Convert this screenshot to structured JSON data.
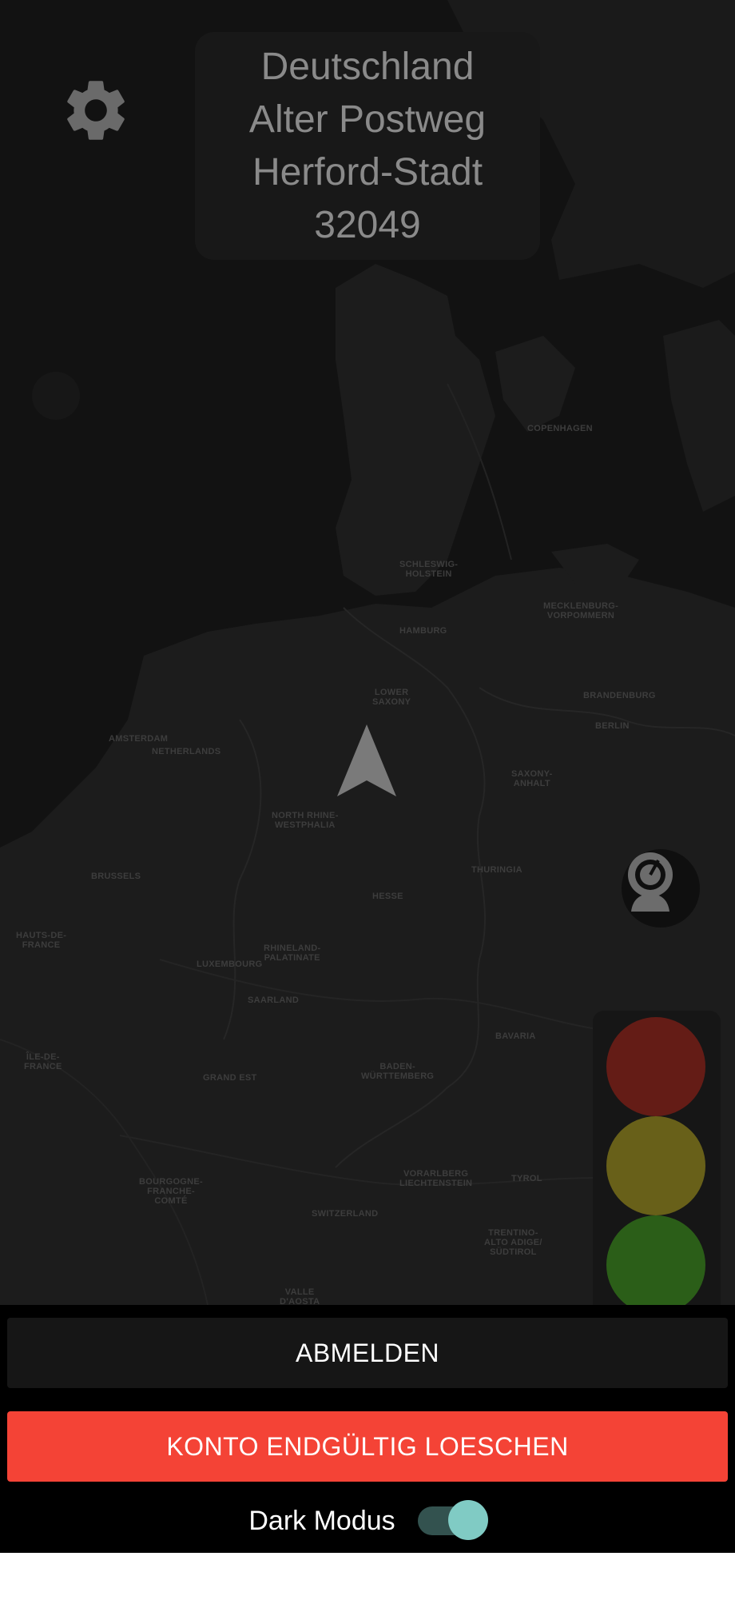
{
  "address": {
    "country": "Deutschland",
    "street": "Alter Postweg",
    "city": "Herford-Stadt",
    "postal_code": "32049"
  },
  "icons": {
    "settings": "gear-icon",
    "navigation": "navigation-arrow-icon",
    "speed_camera": "speed-camera-icon"
  },
  "traffic_light": {
    "red": "#641c16",
    "yellow": "#686019",
    "green": "#2b5e18"
  },
  "map_labels": [
    {
      "text": "SCHLESWIG-\nHOLSTEIN"
    },
    {
      "text": "HAMBURG"
    },
    {
      "text": "MECKLENBURG-\nVORPOMMERN"
    },
    {
      "text": "BRANDENBURG"
    },
    {
      "text": "BERLIN"
    },
    {
      "text": "LOWER\nSAXONY"
    },
    {
      "text": "NETHERLANDS"
    },
    {
      "text": "AMSTERDAM"
    },
    {
      "text": "NORTH RHINE-\nWESTPHALIA"
    },
    {
      "text": "SAXONY-\nANHALT"
    },
    {
      "text": "THURINGIA"
    },
    {
      "text": "HESSE"
    },
    {
      "text": "RHINELAND-\nPALATINATE"
    },
    {
      "text": "LUXEMBOURG"
    },
    {
      "text": "SAARLAND"
    },
    {
      "text": "BAVARIA"
    },
    {
      "text": "BADEN-\nWÜRTTEMBERG"
    },
    {
      "text": "GRAND EST"
    },
    {
      "text": "BOURGOGNE-\nFRANCHE-\nCOMTÉ"
    },
    {
      "text": "SWITZERLAND"
    },
    {
      "text": "VORARLBERG\nLIECHTENSTEIN"
    },
    {
      "text": "TYROL"
    },
    {
      "text": "TRENTINO-\nALTO ADIGE/\nSÜDTIROL"
    },
    {
      "text": "HAUTS-DE-\nFRANCE"
    },
    {
      "text": "ÎLE-DE-\nFRANCE"
    },
    {
      "text": "BRUSSELS"
    },
    {
      "text": "VALLE\nD'AOSTA"
    },
    {
      "text": "COPENHAGEN"
    }
  ],
  "buttons": {
    "logout": "ABMELDEN",
    "delete_account": "KONTO ENDGÜLTIG LOESCHEN"
  },
  "dark_mode": {
    "label": "Dark Modus",
    "enabled": true
  }
}
